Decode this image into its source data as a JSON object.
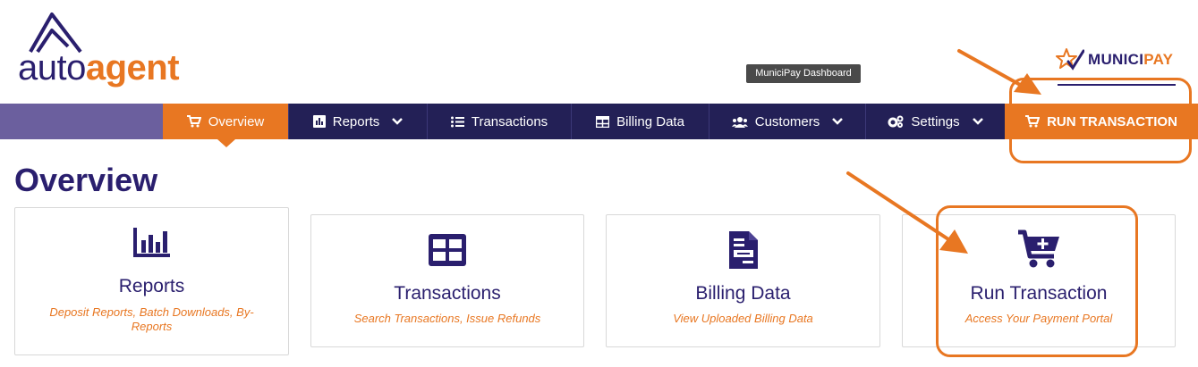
{
  "brand": {
    "logo_part1": "auto",
    "logo_part2": "agent",
    "partner_part1": "MUNICI",
    "partner_part2": "PAY"
  },
  "tooltip": "MuniciPay Dashboard",
  "nav": {
    "items": [
      {
        "label": "Overview",
        "icon": "cart-icon"
      },
      {
        "label": "Reports",
        "icon": "bar-chart-icon"
      },
      {
        "label": "Transactions",
        "icon": "list-icon"
      },
      {
        "label": "Billing Data",
        "icon": "table-icon"
      },
      {
        "label": "Customers",
        "icon": "users-icon"
      },
      {
        "label": "Settings",
        "icon": "gears-icon"
      },
      {
        "label": "RUN TRANSACTION",
        "icon": "cart-icon"
      }
    ]
  },
  "page_title": "Overview",
  "cards": [
    {
      "title": "Reports",
      "subtitle": "Deposit Reports, Batch Downloads, By-Reports",
      "icon": "bar-chart-icon"
    },
    {
      "title": "Transactions",
      "subtitle": "Search Transactions, Issue Refunds",
      "icon": "table-icon"
    },
    {
      "title": "Billing Data",
      "subtitle": "View Uploaded Billing Data",
      "icon": "document-icon"
    },
    {
      "title": "Run Transaction",
      "subtitle": "Access Your Payment Portal",
      "icon": "cart-plus-icon"
    }
  ],
  "colors": {
    "navy": "#232056",
    "brand_purple": "#2a1f6e",
    "accent_orange": "#e87722",
    "nav_left_fill": "#6b5f9e"
  }
}
